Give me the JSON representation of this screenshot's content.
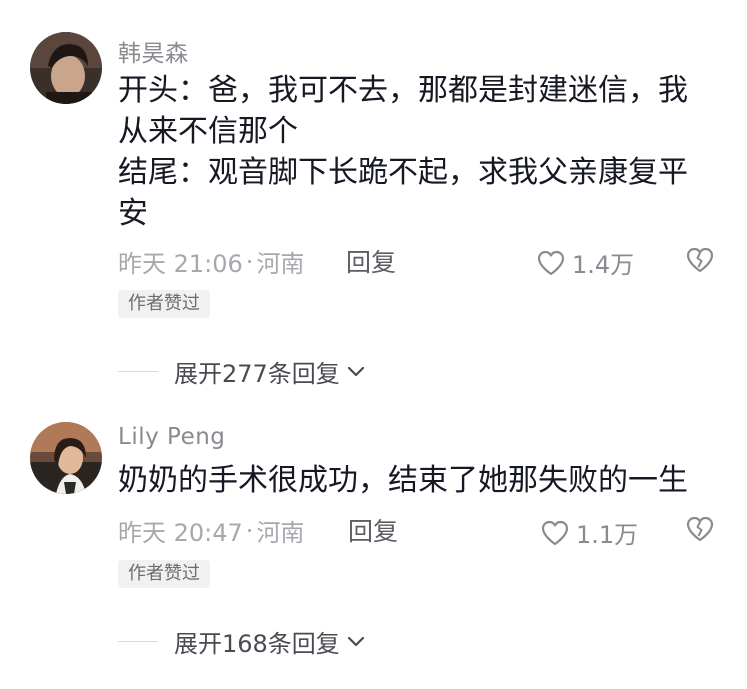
{
  "comments": [
    {
      "username": "韩昊森",
      "content_lines": [
        "开头：爸，我可不去，那都是封建迷信，我",
        "从来不信那个",
        "结尾：观音脚下长跪不起，求我父亲康复平",
        "安"
      ],
      "time": "昨天 21:06",
      "location_sep": "·",
      "location": "河南",
      "reply_label": "回复",
      "like_count": "1.4万",
      "badge": "作者赞过",
      "expand_label": "展开277条回复",
      "avatar_colors": {
        "bg": "#3b2f2a",
        "face": "#c9a58c",
        "hair": "#1e1714"
      }
    },
    {
      "username": "Lily Peng",
      "content_lines": [
        "奶奶的手术很成功，结束了她那失败的一生"
      ],
      "time": "昨天 20:47",
      "location_sep": "·",
      "location": "河南",
      "reply_label": "回复",
      "like_count": "1.1万",
      "badge": "作者赞过",
      "expand_label": "展开168条回复",
      "avatar_colors": {
        "bg": "#6a4a3a",
        "face": "#e2b89a",
        "hair": "#2a1c16"
      }
    }
  ],
  "icons": {
    "like": "heart-outline-icon",
    "dislike": "broken-heart-icon",
    "expand": "chevron-down-icon"
  },
  "colors": {
    "text_primary": "#161823",
    "text_secondary": "#8a8b91",
    "meta": "#a7a8ad",
    "badge_bg": "#f1f1f2"
  }
}
